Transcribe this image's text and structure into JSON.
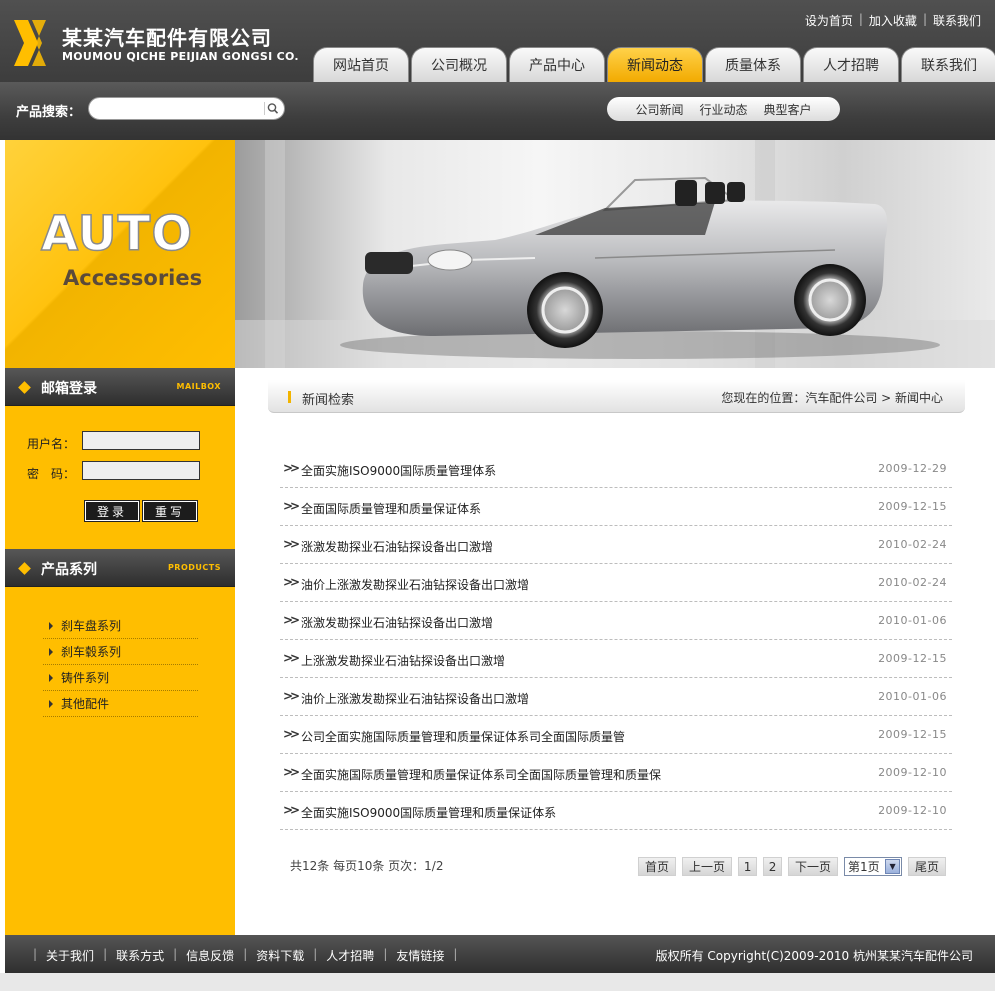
{
  "brand": {
    "name_cn": "某某汽车配件有限公司",
    "name_en": "MOUMOU QICHE PEIJIAN GONGSI CO.",
    "accent_color": "#ffbe00",
    "logo_icon": "logo-mark"
  },
  "toplinks": [
    "设为首页",
    "加入收藏",
    "联系我们"
  ],
  "nav": {
    "tabs": [
      {
        "label": "网站首页"
      },
      {
        "label": "公司概况"
      },
      {
        "label": "产品中心"
      },
      {
        "label": "新闻动态",
        "active": true
      },
      {
        "label": "质量体系"
      },
      {
        "label": "人才招聘"
      },
      {
        "label": "联系我们"
      }
    ]
  },
  "search": {
    "label": "产品搜索：",
    "value": "",
    "icon": "search-icon"
  },
  "subnav": [
    "公司新闻",
    "行业动态",
    "典型客户"
  ],
  "banner": {
    "title": "AUTO",
    "subtitle": "Accessories"
  },
  "mailbox": {
    "title": "邮箱登录",
    "title_en": "MAILBOX",
    "user_label": "用户名：",
    "pass_label": "密　码：",
    "login_btn": "登录",
    "reset_btn": "重写"
  },
  "products": {
    "title": "产品系列",
    "title_en": "PRODUCTS",
    "items": [
      "刹车盘系列",
      "刹车毂系列",
      "铸件系列",
      "其他配件"
    ]
  },
  "main": {
    "title": "新闻检索",
    "breadcrumb": "您现在的位置：汽车配件公司 > 新闻中心",
    "news": [
      {
        "title": "全面实施ISO9000国际质量管理体系",
        "date": "2009-12-29"
      },
      {
        "title": "全面国际质量管理和质量保证体系",
        "date": "2009-12-15"
      },
      {
        "title": "涨激发勘探业石油钻探设备出口激增",
        "date": "2010-02-24"
      },
      {
        "title": "油价上涨激发勘探业石油钻探设备出口激增",
        "date": "2010-02-24"
      },
      {
        "title": "涨激发勘探业石油钻探设备出口激增",
        "date": "2010-01-06"
      },
      {
        "title": "上涨激发勘探业石油钻探设备出口激增",
        "date": "2009-12-15"
      },
      {
        "title": "油价上涨激发勘探业石油钻探设备出口激增",
        "date": "2010-01-06"
      },
      {
        "title": "公司全面实施国际质量管理和质量保证体系司全面国际质量管",
        "date": "2009-12-15"
      },
      {
        "title": "全面实施国际质量管理和质量保证体系司全面国际质量管理和质量保",
        "date": "2009-12-10"
      },
      {
        "title": "全面实施ISO9000国际质量管理和质量保证体系",
        "date": "2009-12-10"
      }
    ],
    "pager": {
      "info": "共12条  每页10条  页次：1/2",
      "first": "首页",
      "prev": "上一页",
      "pages": [
        "1",
        "2"
      ],
      "next": "下一页",
      "select_value": "第1页",
      "last": "尾页"
    }
  },
  "footer": {
    "links": [
      "关于我们",
      "联系方式",
      "信息反馈",
      "资料下载",
      "人才招聘",
      "友情链接"
    ],
    "copyright": "版权所有  Copyright(C)2009-2010 杭州某某汽车配件公司"
  }
}
